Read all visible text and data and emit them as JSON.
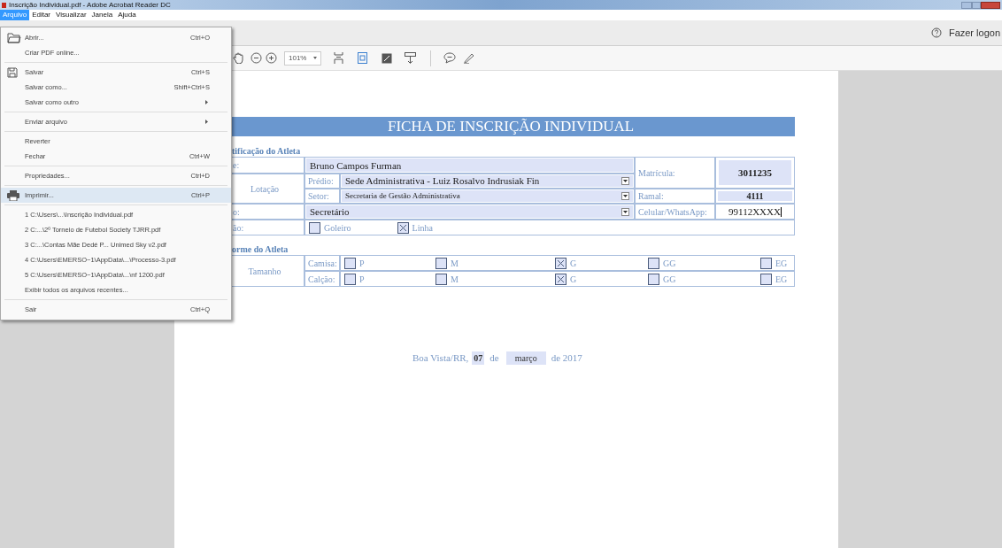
{
  "window": {
    "title": "Inscrição Individual.pdf - Adobe Acrobat Reader DC"
  },
  "menubar": [
    {
      "label": "Arquivo",
      "selected": true
    },
    {
      "label": "Editar",
      "selected": false
    },
    {
      "label": "Visualizar",
      "selected": false
    },
    {
      "label": "Janela",
      "selected": false
    },
    {
      "label": "Ajuda",
      "selected": false
    }
  ],
  "file_menu": {
    "groups": [
      [
        {
          "label": "Abrir...",
          "shortcut": "Ctrl+O",
          "submenu": false,
          "highlighted": false
        },
        {
          "label": "Criar PDF online...",
          "submenu": false,
          "highlighted": false
        }
      ],
      [
        {
          "label": "Salvar",
          "shortcut": "Ctrl+S",
          "submenu": false,
          "highlighted": false
        },
        {
          "label": "Salvar como...",
          "shortcut": "Shift+Ctrl+S",
          "submenu": false,
          "highlighted": false
        },
        {
          "label": "Salvar como outro",
          "submenu": true,
          "highlighted": false
        }
      ],
      [
        {
          "label": "Enviar arquivo",
          "submenu": true,
          "highlighted": false
        }
      ],
      [
        {
          "label": "Reverter",
          "submenu": false,
          "highlighted": false
        },
        {
          "label": "Fechar",
          "shortcut": "Ctrl+W",
          "submenu": false,
          "highlighted": false
        }
      ],
      [
        {
          "label": "Propriedades...",
          "shortcut": "Ctrl+D",
          "submenu": false,
          "highlighted": false
        }
      ],
      [
        {
          "label": "Imprimir...",
          "shortcut": "Ctrl+P",
          "submenu": false,
          "highlighted": true
        }
      ],
      [
        {
          "label": "1 C:\\Users\\...\\Inscrição Individual.pdf",
          "submenu": false,
          "highlighted": false
        },
        {
          "label": "2 C:...\\2º Torneio de Futebol Society TJRR.pdf",
          "submenu": false,
          "highlighted": false
        },
        {
          "label": "3 C:...\\Contas Mãe Dedé P... Unimed Sky v2.pdf",
          "submenu": false,
          "highlighted": false
        },
        {
          "label": "4 C:\\Users\\EMERSO~1\\AppData\\...\\Processo-3.pdf",
          "submenu": false,
          "highlighted": false
        },
        {
          "label": "5 C:\\Users\\EMERSO~1\\AppData\\...\\nf 1200.pdf",
          "submenu": false,
          "highlighted": false
        },
        {
          "label": "Exibir todos os arquivos recentes...",
          "submenu": false,
          "highlighted": false
        }
      ],
      [
        {
          "label": "Sair",
          "shortcut": "Ctrl+Q",
          "submenu": false,
          "highlighted": false
        }
      ]
    ]
  },
  "account": {
    "label": "Fazer logon"
  },
  "toolbar": {
    "zoom": "101%"
  },
  "form": {
    "title": "FICHA DE INSCRIÇÃO INDIVIDUAL",
    "identification": {
      "heading": "tificação do Atleta",
      "name_label": "e:",
      "name": "Bruno Campos Furman",
      "lotacao_label": "Lotação",
      "predio_label": "Prédio:",
      "predio": "Sede Administrativa - Luiz Rosalvo Indrusiak Fin",
      "setor_label": "Setor:",
      "setor": "Secretaria de Gestão Administrativa",
      "cargo_label": "o:",
      "cargo": "Secretário",
      "posicao_label": "ão:",
      "positions": [
        {
          "label": "Goleiro",
          "checked": false
        },
        {
          "label": "Linha",
          "checked": true
        }
      ],
      "matricula_label": "Matrícula:",
      "matricula": "3011235",
      "ramal_label": "Ramal:",
      "ramal": "4111",
      "celular_label": "Celular/WhatsApp:",
      "celular": "99112XXXX"
    },
    "uniform": {
      "heading": "orme do Atleta",
      "size_label": "Tamanho",
      "rows": [
        {
          "label": "Camisa:",
          "options": [
            {
              "label": "P",
              "checked": false
            },
            {
              "label": "M",
              "checked": false
            },
            {
              "label": "G",
              "checked": true
            },
            {
              "label": "GG",
              "checked": false
            },
            {
              "label": "EG",
              "checked": false
            }
          ]
        },
        {
          "label": "Calção:",
          "options": [
            {
              "label": "P",
              "checked": false
            },
            {
              "label": "M",
              "checked": false
            },
            {
              "label": "G",
              "checked": true
            },
            {
              "label": "GG",
              "checked": false
            },
            {
              "label": "EG",
              "checked": false
            }
          ]
        }
      ]
    },
    "date": {
      "city": "Boa Vista/RR,",
      "day": "07",
      "de": "de",
      "month": "março",
      "year": "de 2017"
    }
  }
}
